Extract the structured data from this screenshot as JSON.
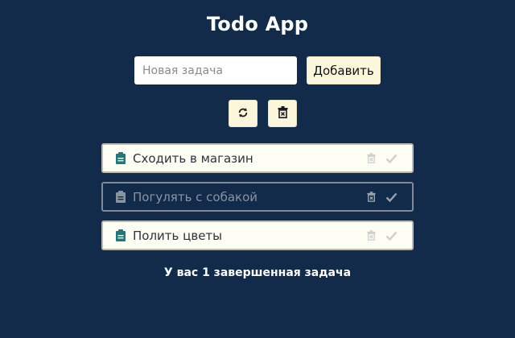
{
  "app": {
    "title": "Todo App"
  },
  "form": {
    "placeholder": "Новая задача",
    "value": "",
    "add_label": "Добавить"
  },
  "toolbar": {
    "refresh_icon": "refresh-icon",
    "clear_icon": "trash-x-icon"
  },
  "tasks": [
    {
      "label": "Сходить в магазин",
      "completed": false
    },
    {
      "label": "Погулять с собакой",
      "completed": true
    },
    {
      "label": "Полить цветы",
      "completed": false
    }
  ],
  "summary": {
    "text": "У вас 1 завершенная задача"
  },
  "colors": {
    "background": "#132b4b",
    "button_bg": "#fbf6dc",
    "note_icon_active": "#1c7a78",
    "note_icon_done": "#8a93a0"
  }
}
